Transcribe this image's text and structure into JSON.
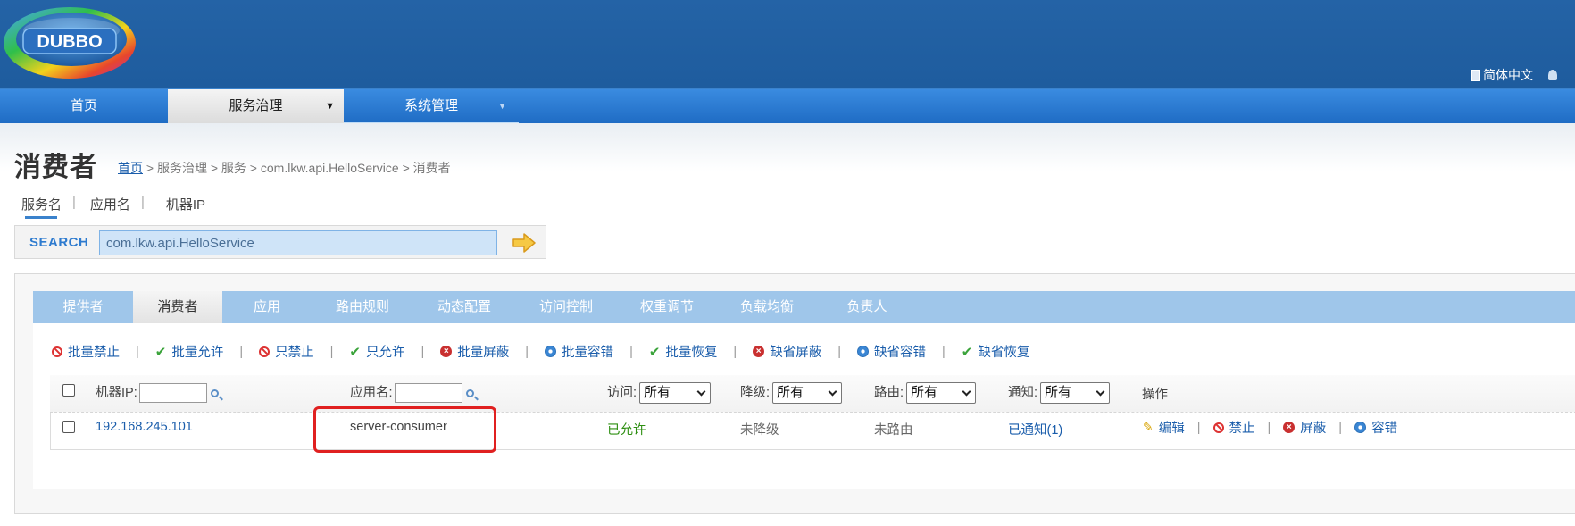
{
  "header": {
    "logo_text": "DUBBO",
    "language": "简体中文"
  },
  "nav": {
    "items": [
      {
        "label": "首页"
      },
      {
        "label": "服务治理",
        "caret": "▼"
      },
      {
        "label": "系统管理",
        "caret": "▼"
      }
    ]
  },
  "page": {
    "title": "消费者",
    "breadcrumb": {
      "home": "首页",
      "rest": " > 服务治理 > 服务 > com.lkw.api.HelloService > 消费者"
    }
  },
  "search": {
    "types": [
      "服务名",
      "应用名",
      "机器IP"
    ],
    "separator": "|",
    "label": "SEARCH",
    "value": "com.lkw.api.HelloService"
  },
  "tabs": [
    "提供者",
    "消费者",
    "应用",
    "路由规则",
    "动态配置",
    "访问控制",
    "权重调节",
    "负载均衡",
    "负责人"
  ],
  "actions": [
    {
      "label": "批量禁止",
      "icon": "ban-icon"
    },
    {
      "label": "批量允许",
      "icon": "check-icon"
    },
    {
      "label": "只禁止",
      "icon": "ban-icon"
    },
    {
      "label": "只允许",
      "icon": "check-icon"
    },
    {
      "label": "批量屏蔽",
      "icon": "x-circle-icon"
    },
    {
      "label": "批量容错",
      "icon": "gear-icon"
    },
    {
      "label": "批量恢复",
      "icon": "check-icon"
    },
    {
      "label": "缺省屏蔽",
      "icon": "x-circle-icon"
    },
    {
      "label": "缺省容错",
      "icon": "gear-icon"
    },
    {
      "label": "缺省恢复",
      "icon": "check-icon"
    }
  ],
  "table": {
    "headers": {
      "ip": "机器IP:",
      "app": "应用名:",
      "access": "访问:",
      "degrade": "降级:",
      "route": "路由:",
      "notify": "通知:",
      "ops": "操作"
    },
    "filter_all": "所有",
    "rows": [
      {
        "ip": "192.168.245.101",
        "app": "server-consumer",
        "access": "已允许",
        "degrade": "未降级",
        "route": "未路由",
        "notify": "已通知(1)",
        "ops": [
          {
            "label": "编辑",
            "icon": "pencil-icon"
          },
          {
            "label": "禁止",
            "icon": "ban-icon"
          },
          {
            "label": "屏蔽",
            "icon": "x-circle-icon"
          },
          {
            "label": "容错",
            "icon": "gear-icon"
          }
        ]
      }
    ]
  },
  "colors": {
    "header_blue": "#1e5c9e",
    "nav_blue": "#2a7ad4",
    "tab_blue": "#9fc6ea",
    "link": "#1a5dab",
    "highlight": "#e02020"
  }
}
